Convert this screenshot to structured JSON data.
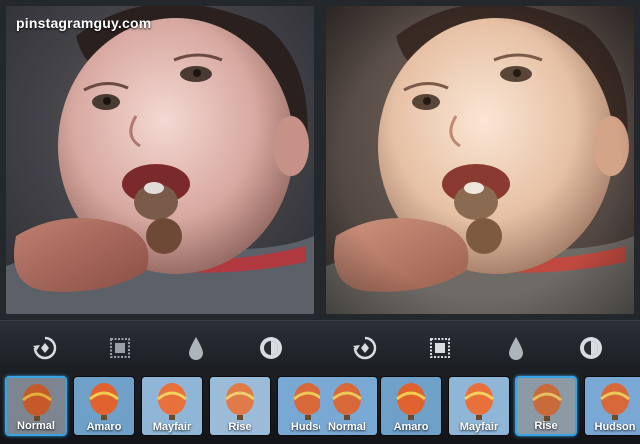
{
  "watermark": "pinstagramguy.com",
  "colors": {
    "selection_border": "#3aa3e3",
    "toolbar_icon": "#d9dde2"
  },
  "toolbar": {
    "icons": [
      "rotate-icon",
      "frame-border-icon",
      "drop-blur-icon",
      "brightness-icon"
    ]
  },
  "panels": [
    {
      "side": "left",
      "filter_applied": "Normal",
      "filters": [
        {
          "label": "Normal",
          "selected": true
        },
        {
          "label": "Amaro",
          "selected": false
        },
        {
          "label": "Mayfair",
          "selected": false
        },
        {
          "label": "Rise",
          "selected": false
        },
        {
          "label": "Hudso",
          "selected": false
        }
      ]
    },
    {
      "side": "right",
      "filter_applied": "Rise",
      "filters": [
        {
          "label": "Normal",
          "selected": false
        },
        {
          "label": "Amaro",
          "selected": false
        },
        {
          "label": "Mayfair",
          "selected": false
        },
        {
          "label": "Rise",
          "selected": true
        },
        {
          "label": "Hudson",
          "selected": false
        }
      ]
    }
  ]
}
